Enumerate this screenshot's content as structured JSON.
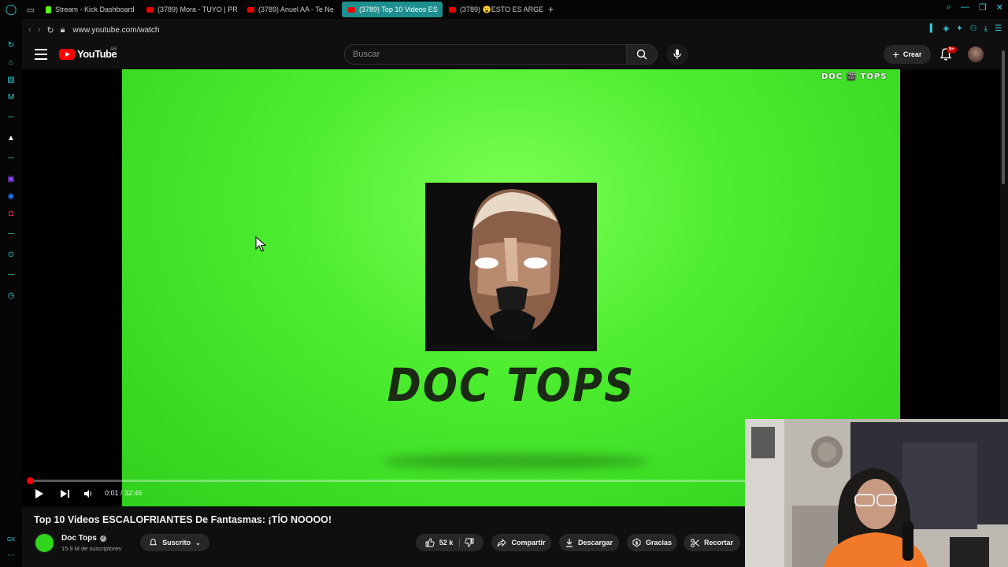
{
  "browser": {
    "tabs": [
      {
        "title": "Stream - Kick Dashboard",
        "favicon": "kick-icon",
        "active": false
      },
      {
        "title": "(3789) Mora - TUYO | PR",
        "favicon": "youtube-icon",
        "active": false
      },
      {
        "title": "(3789) Anuel AA - Te Ne",
        "favicon": "youtube-icon",
        "active": false
      },
      {
        "title": "(3789) Top 10 Videos ES",
        "favicon": "youtube-icon",
        "active": true
      },
      {
        "title": "(3789) 😮ESTO ES ARGE",
        "favicon": "youtube-icon",
        "active": false
      }
    ],
    "new_tab_label": "+",
    "url": "www.youtube.com/watch",
    "accent_color": "#3ad0e0"
  },
  "youtube": {
    "logo_text": "YouTube",
    "country_code": "AR",
    "search_placeholder": "Buscar",
    "create_label": "Crear",
    "notifications_badge": "9+"
  },
  "player": {
    "watermark_text": "DOC 🎬 TOPS",
    "wordmark_text": "DOC TOPS",
    "time": "0:01 / 32:46",
    "progress_fraction": 0.0005,
    "background_color": "#4ded2f"
  },
  "video": {
    "title": "Top 10 Videos ESCALOFRIANTES De Fantasmas: ¡TÍO NOOOO!",
    "channel_name": "Doc Tops",
    "subscribers": "15.9 M de suscriptores",
    "subscribe_label": "Suscrito",
    "likes": "52 k",
    "share_label": "Compartir",
    "download_label": "Descargar",
    "thanks_label": "Gracias",
    "clip_label": "Recortar"
  }
}
